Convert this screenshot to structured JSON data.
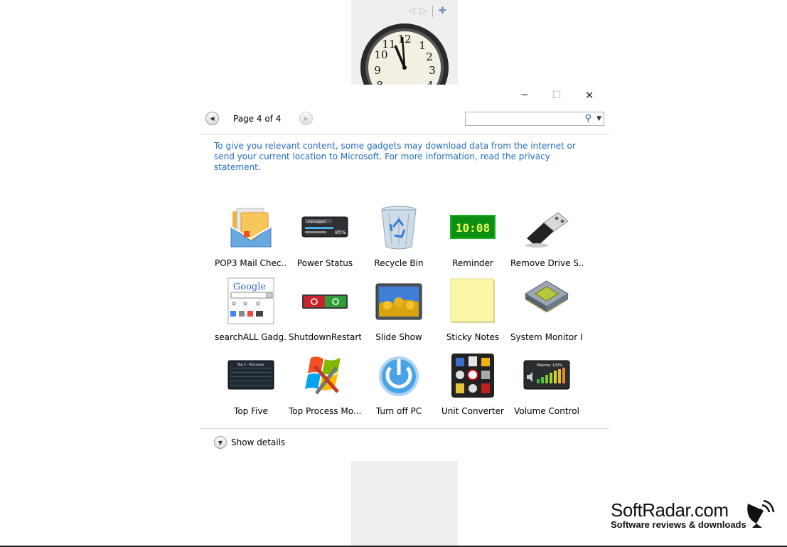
{
  "window": {
    "pager_label": "Page 4 of 4",
    "search": {
      "value": "",
      "placeholder": ""
    },
    "notice": "To give you relevant content, some gadgets may download data from the internet or send your current location to Microsoft. For more information, read the privacy statement.",
    "show_details": "Show details"
  },
  "gadgets": [
    {
      "name": "POP3 Mail Chec...",
      "icon": "mail-icon"
    },
    {
      "name": "Power Status",
      "icon": "battery-icon"
    },
    {
      "name": "Recycle Bin",
      "icon": "recycle-bin-icon"
    },
    {
      "name": "Reminder",
      "icon": "digital-clock-icon",
      "display": "10:08"
    },
    {
      "name": "Remove Drive S...",
      "icon": "usb-drive-icon"
    },
    {
      "name": "searchALL Gadg...",
      "icon": "google-search-icon",
      "display": "Google"
    },
    {
      "name": "ShutdownRestart",
      "icon": "power-buttons-icon"
    },
    {
      "name": "Slide Show",
      "icon": "slideshow-icon"
    },
    {
      "name": "Sticky Notes",
      "icon": "sticky-note-icon"
    },
    {
      "name": "System Monitor II",
      "icon": "cpu-chip-icon"
    },
    {
      "name": "Top Five",
      "icon": "process-list-icon",
      "display": "Top 5 - Processor"
    },
    {
      "name": "Top Process Mo...",
      "icon": "windows-tools-icon"
    },
    {
      "name": "Turn off PC",
      "icon": "power-icon"
    },
    {
      "name": "Unit Converter",
      "icon": "converter-icon"
    },
    {
      "name": "Volume Control",
      "icon": "volume-icon",
      "display": "Volume: 100%"
    }
  ],
  "power_status_text": "Unplugged",
  "watermark": {
    "title": "SoftRadar.com",
    "subtitle": "Software reviews & downloads"
  },
  "colors": {
    "link_blue": "#1f6dc2",
    "reminder_green": "#19b320"
  }
}
